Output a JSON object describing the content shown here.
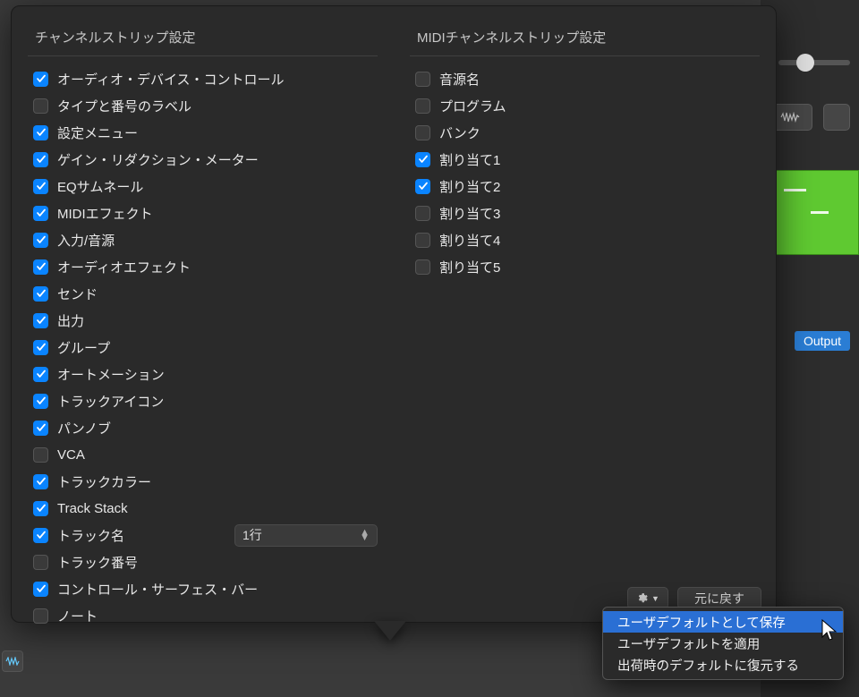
{
  "leftSection": {
    "title": "チャンネルストリップ設定",
    "items": [
      {
        "label": "オーディオ・デバイス・コントロール",
        "checked": true
      },
      {
        "label": "タイプと番号のラベル",
        "checked": false
      },
      {
        "label": "設定メニュー",
        "checked": true
      },
      {
        "label": "ゲイン・リダクション・メーター",
        "checked": true
      },
      {
        "label": "EQサムネール",
        "checked": true
      },
      {
        "label": "MIDIエフェクト",
        "checked": true
      },
      {
        "label": "入力/音源",
        "checked": true
      },
      {
        "label": "オーディオエフェクト",
        "checked": true
      },
      {
        "label": "センド",
        "checked": true
      },
      {
        "label": "出力",
        "checked": true
      },
      {
        "label": "グループ",
        "checked": true
      },
      {
        "label": "オートメーション",
        "checked": true
      },
      {
        "label": "トラックアイコン",
        "checked": true
      },
      {
        "label": "パンノブ",
        "checked": true
      },
      {
        "label": "VCA",
        "checked": false
      },
      {
        "label": "トラックカラー",
        "checked": true
      },
      {
        "label": "Track Stack",
        "checked": true
      },
      {
        "label": "トラック名",
        "checked": true,
        "select": "1行"
      },
      {
        "label": "トラック番号",
        "checked": false
      },
      {
        "label": "コントロール・サーフェス・バー",
        "checked": true
      },
      {
        "label": "ノート",
        "checked": false
      }
    ]
  },
  "rightSection": {
    "title": "MIDIチャンネルストリップ設定",
    "items": [
      {
        "label": "音源名",
        "checked": false
      },
      {
        "label": "プログラム",
        "checked": false
      },
      {
        "label": "バンク",
        "checked": false
      },
      {
        "label": "割り当て1",
        "checked": true
      },
      {
        "label": "割り当て2",
        "checked": true
      },
      {
        "label": "割り当て3",
        "checked": false
      },
      {
        "label": "割り当て4",
        "checked": false
      },
      {
        "label": "割り当て5",
        "checked": false
      }
    ]
  },
  "footer": {
    "revert": "元に戻す"
  },
  "dropdown": {
    "items": [
      "ユーザデフォルトとして保存",
      "ユーザデフォルトを適用",
      "出荷時のデフォルトに復元する"
    ],
    "selectedIndex": 0
  },
  "bg": {
    "outputTag": "Output"
  }
}
